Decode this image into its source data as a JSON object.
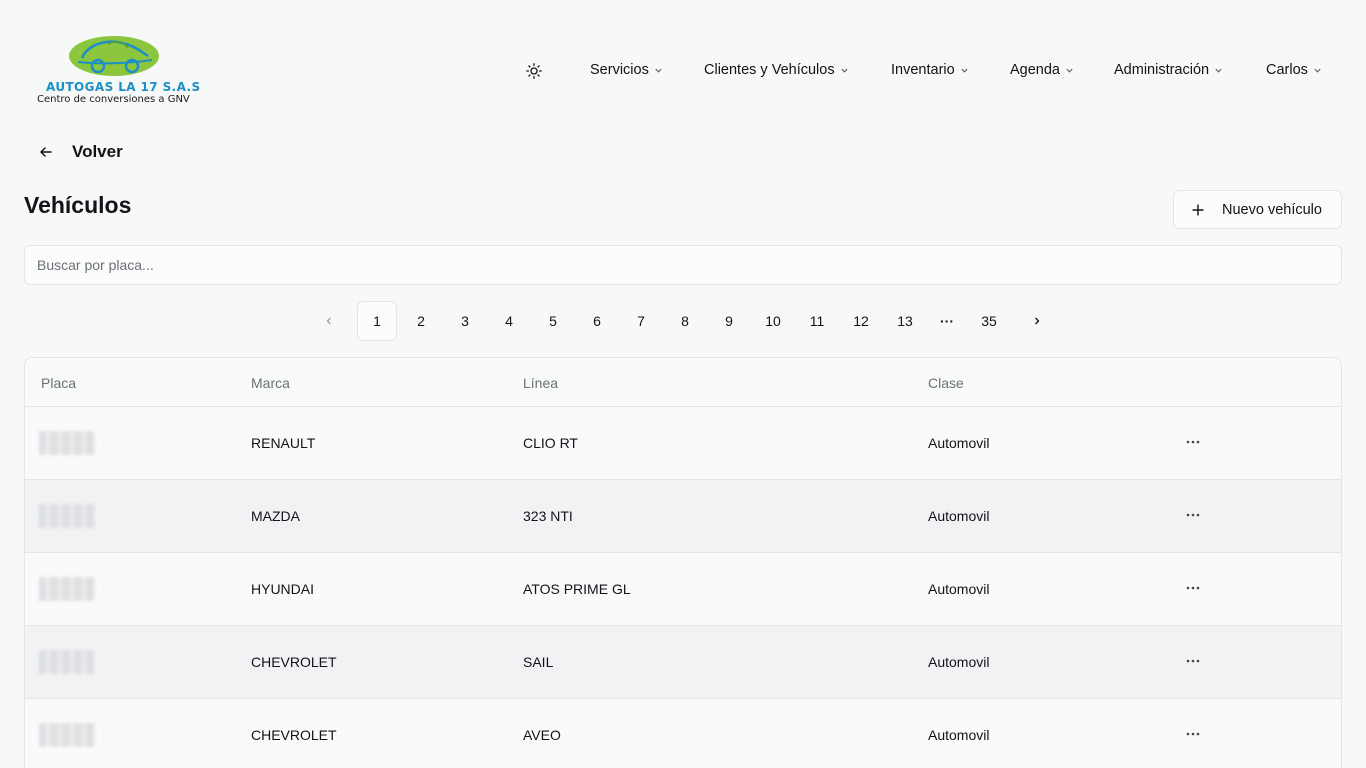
{
  "brand": {
    "name": "AUTOGAS LA 17 S.A.S",
    "tagline": "Centro de conversiones a GNV",
    "colors": {
      "blue": "#1c8fc7",
      "green": "#8cc63f"
    }
  },
  "nav": {
    "theme_icon": "sun-icon",
    "items": [
      {
        "label": "Servicios"
      },
      {
        "label": "Clientes y Vehículos"
      },
      {
        "label": "Inventario"
      },
      {
        "label": "Agenda"
      },
      {
        "label": "Administración"
      },
      {
        "label": "Carlos"
      }
    ]
  },
  "back": {
    "label": "Volver"
  },
  "page": {
    "title": "Vehículos",
    "new_button": "Nuevo vehículo"
  },
  "search": {
    "placeholder": "Buscar por placa...",
    "value": ""
  },
  "pagination": {
    "current": "1",
    "pages": [
      "1",
      "2",
      "3",
      "4",
      "5",
      "6",
      "7",
      "8",
      "9",
      "10",
      "11",
      "12",
      "13"
    ],
    "ellipsis": "···",
    "last": "35"
  },
  "table": {
    "headers": {
      "placa": "Placa",
      "marca": "Marca",
      "linea": "Línea",
      "clase": "Clase"
    },
    "rows": [
      {
        "marca": "RENAULT",
        "linea": "CLIO RT",
        "clase": "Automovil"
      },
      {
        "marca": "MAZDA",
        "linea": "323 NTI",
        "clase": "Automovil"
      },
      {
        "marca": "HYUNDAI",
        "linea": "ATOS PRIME GL",
        "clase": "Automovil"
      },
      {
        "marca": "CHEVROLET",
        "linea": "SAIL",
        "clase": "Automovil"
      },
      {
        "marca": "CHEVROLET",
        "linea": "AVEO",
        "clase": "Automovil"
      }
    ]
  }
}
